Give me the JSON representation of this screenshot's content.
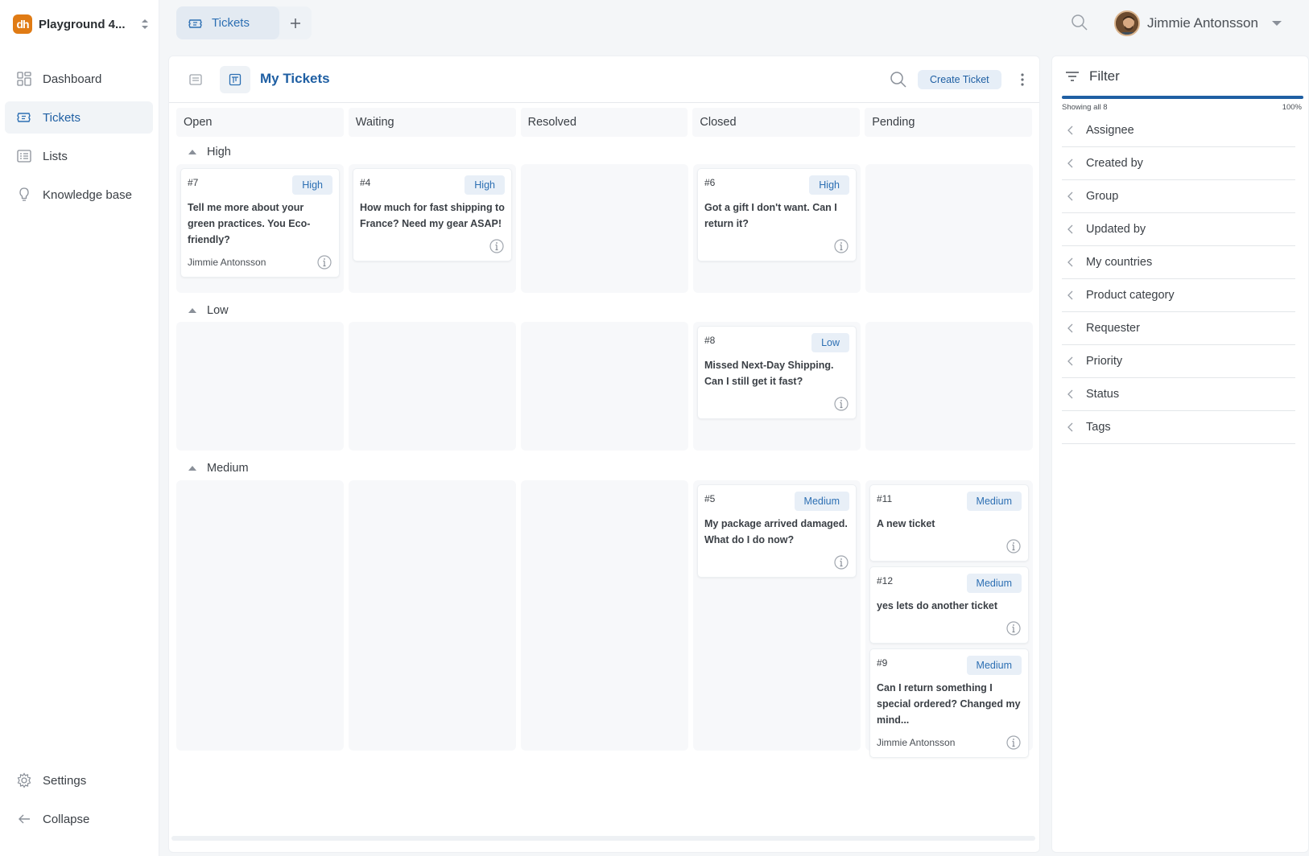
{
  "brand": {
    "logo_text": "dh",
    "name": "Playground 4..."
  },
  "sidebar": {
    "items": [
      {
        "label": "Dashboard",
        "icon": "dashboard-icon"
      },
      {
        "label": "Tickets",
        "icon": "ticket-icon"
      },
      {
        "label": "Lists",
        "icon": "list-icon"
      },
      {
        "label": "Knowledge base",
        "icon": "lightbulb-icon"
      }
    ],
    "bottom": [
      {
        "label": "Settings",
        "icon": "gear-icon"
      },
      {
        "label": "Collapse",
        "icon": "arrow-left-icon"
      }
    ]
  },
  "tabs": [
    {
      "label": "Tickets",
      "icon": "ticket-icon"
    }
  ],
  "user": {
    "name": "Jimmie Antonsson"
  },
  "main": {
    "title": "My Tickets",
    "create_label": "Create Ticket",
    "columns": [
      "Open",
      "Waiting",
      "Resolved",
      "Closed",
      "Pending"
    ],
    "groups": [
      {
        "name": "High",
        "cells": [
          [
            {
              "id": "#7",
              "priority": "High",
              "title": "Tell me more about your green practices. You Eco-friendly?",
              "assignee": "Jimmie Antonsson"
            }
          ],
          [
            {
              "id": "#4",
              "priority": "High",
              "title": "How much for fast shipping to France? Need my gear ASAP!",
              "assignee": ""
            }
          ],
          [],
          [
            {
              "id": "#6",
              "priority": "High",
              "title": "Got a gift I don't want. Can I return it?",
              "assignee": ""
            }
          ],
          []
        ]
      },
      {
        "name": "Low",
        "cells": [
          [],
          [],
          [],
          [
            {
              "id": "#8",
              "priority": "Low",
              "title": "Missed Next-Day Shipping. Can I still get it fast?",
              "assignee": ""
            }
          ],
          []
        ]
      },
      {
        "name": "Medium",
        "cells": [
          [],
          [],
          [],
          [
            {
              "id": "#5",
              "priority": "Medium",
              "title": "My package arrived damaged. What do I do now?",
              "assignee": ""
            }
          ],
          [
            {
              "id": "#11",
              "priority": "Medium",
              "title": "A new ticket",
              "assignee": ""
            },
            {
              "id": "#12",
              "priority": "Medium",
              "title": "yes lets do another ticket",
              "assignee": ""
            },
            {
              "id": "#9",
              "priority": "Medium",
              "title": "Can I return something I special ordered? Changed my mind...",
              "assignee": "Jimmie Antonsson"
            }
          ]
        ]
      }
    ]
  },
  "filter": {
    "title": "Filter",
    "progress_label": "Showing all 8",
    "progress_percent": "100%",
    "progress_value": 1.0,
    "facets": [
      "Assignee",
      "Created by",
      "Group",
      "Updated by",
      "My countries",
      "Product category",
      "Requester",
      "Priority",
      "Status",
      "Tags"
    ]
  },
  "colors": {
    "accent": "#1f5fa3",
    "badge_bg": "#e8eff7",
    "brand": "#e07b14"
  }
}
